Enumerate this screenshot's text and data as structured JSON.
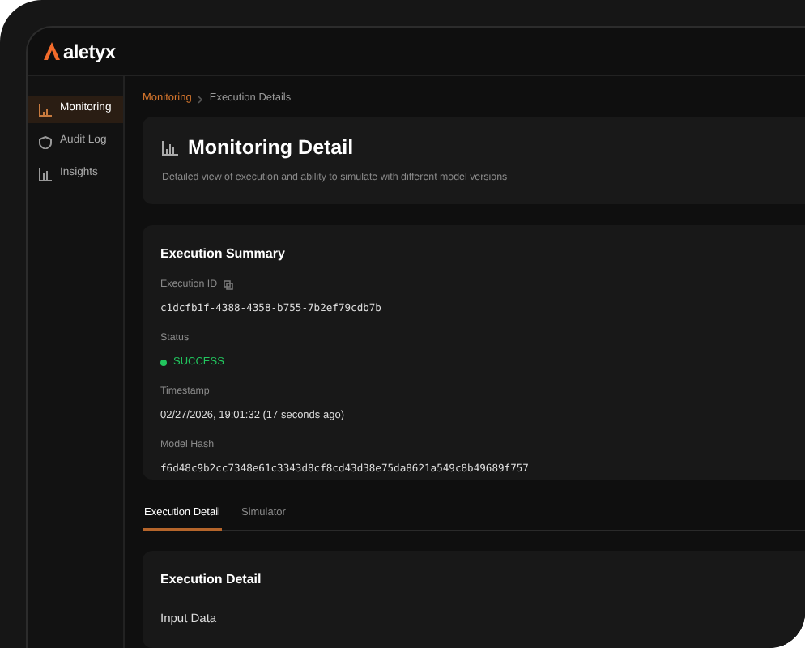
{
  "brand": {
    "name": "aletyx"
  },
  "sidebar": {
    "items": [
      {
        "label": "Monitoring",
        "kind": "chart",
        "selected": true
      },
      {
        "label": "Audit Log",
        "kind": "shield",
        "selected": false
      },
      {
        "label": "Insights",
        "kind": "bars",
        "selected": false
      }
    ]
  },
  "breadcrumb": [
    "Monitoring",
    "Execution Details"
  ],
  "header": {
    "title": "Monitoring Detail",
    "subtitle": "Detailed view of execution and ability to simulate with different model versions"
  },
  "summary": {
    "title": "Execution Summary",
    "fields": [
      {
        "label": "Execution ID",
        "kind": "mono",
        "copyable": true,
        "value": "c1dcfb1f-4388-4358-b755-7b2ef79cdb7b"
      },
      {
        "label": "Status",
        "kind": "status",
        "value": "SUCCESS",
        "color": "#22c55e"
      },
      {
        "label": "Timestamp",
        "kind": "text",
        "value": "02/27/2026, 19:01:32 (17 seconds ago)"
      },
      {
        "label": "Model Hash",
        "kind": "mono",
        "value": "f6d48c9b2cc7348e61c3343d8cf8cd43d38e75da8621a549c8b49689f757"
      }
    ]
  },
  "tabs": [
    {
      "label": "Execution Detail",
      "selected": true
    },
    {
      "label": "Simulator",
      "selected": false
    }
  ],
  "detail": {
    "title": "Execution Detail",
    "section": "Input Data"
  }
}
